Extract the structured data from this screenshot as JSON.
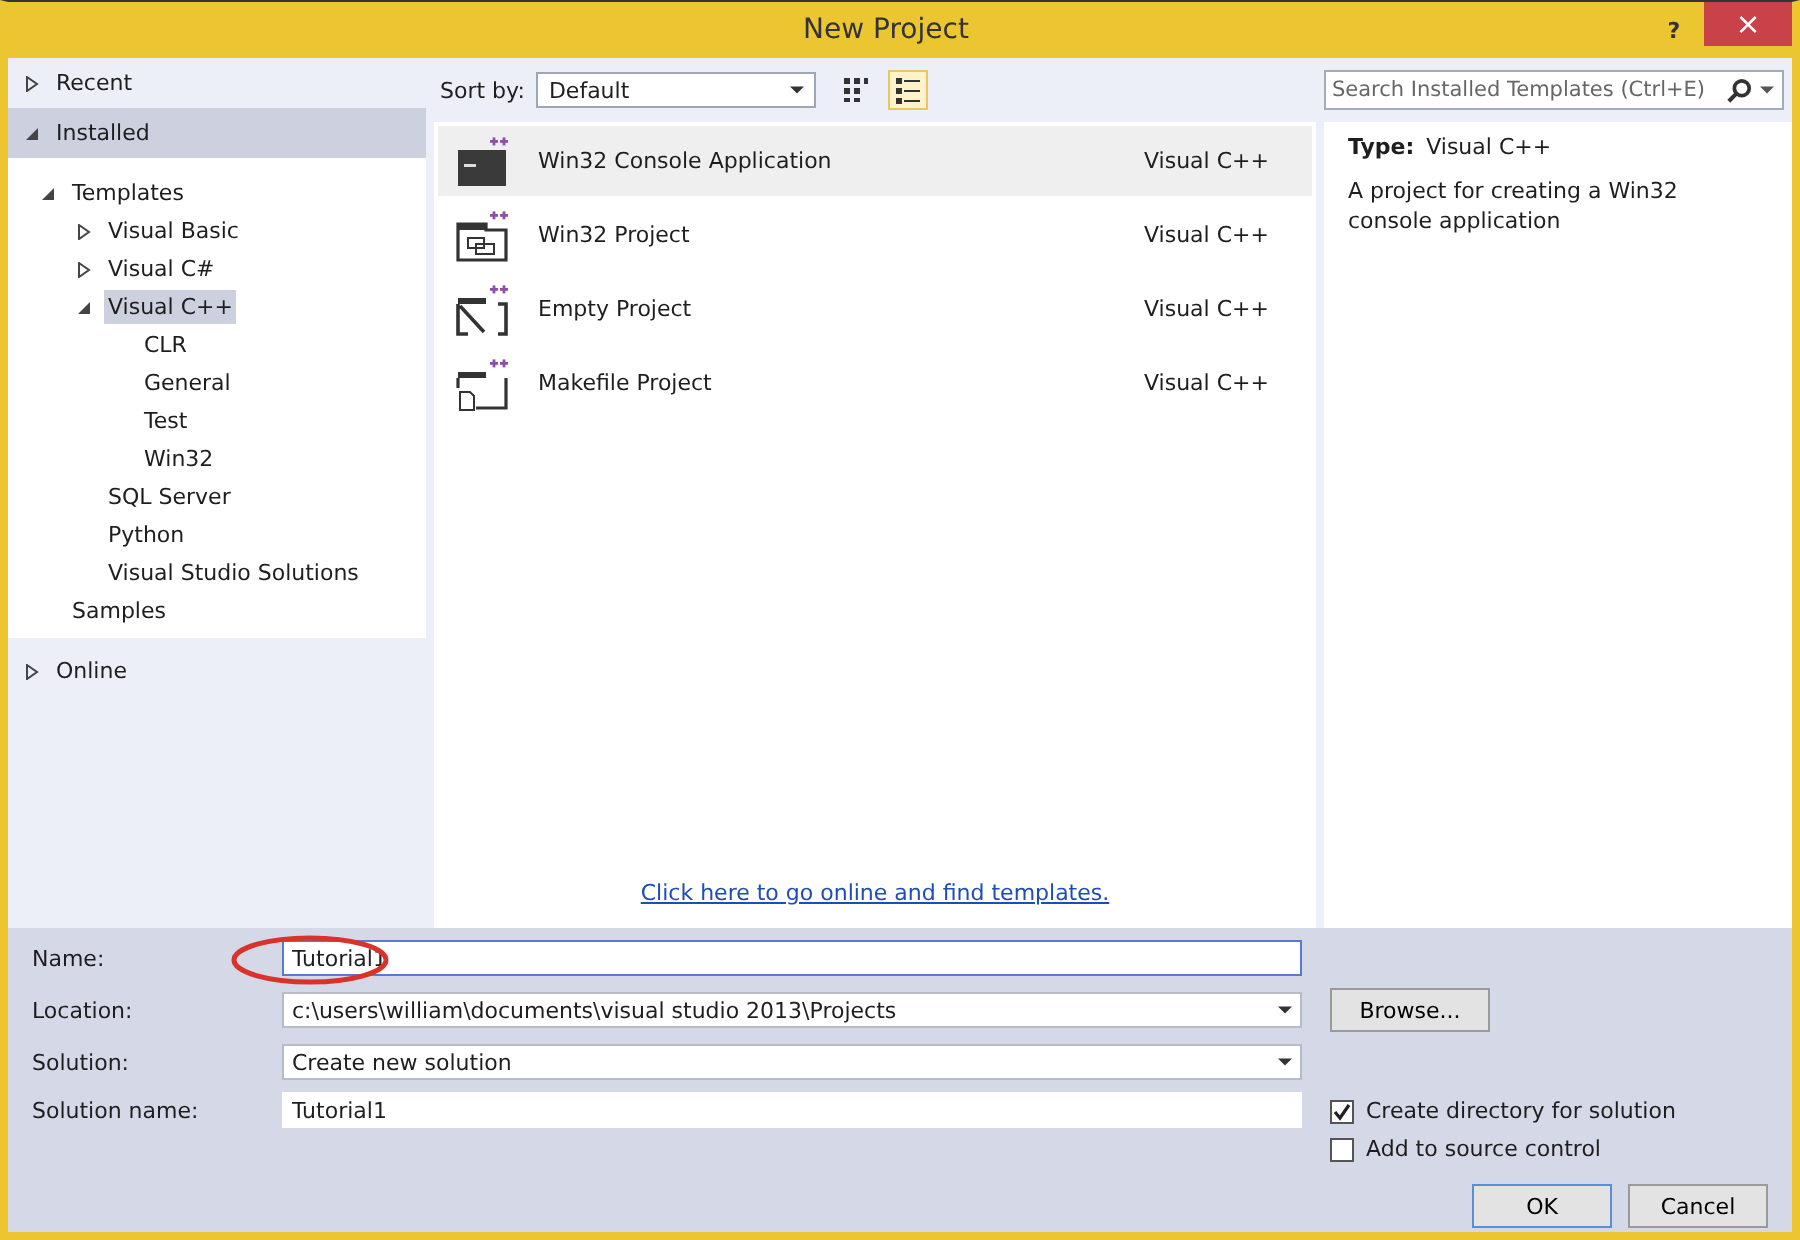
{
  "window": {
    "title": "New Project",
    "help": "?",
    "close": "×"
  },
  "sidebar": {
    "sections": [
      {
        "label": "Recent",
        "expanded": false,
        "selected": false
      },
      {
        "label": "Installed",
        "expanded": true,
        "selected": true,
        "tree": [
          {
            "label": "Templates",
            "expanded": true,
            "selected": false,
            "children": [
              {
                "label": "Visual Basic",
                "expanded": false,
                "selected": false
              },
              {
                "label": "Visual C#",
                "expanded": false,
                "selected": false
              },
              {
                "label": "Visual C++",
                "expanded": true,
                "selected": true,
                "children": [
                  {
                    "label": "CLR",
                    "selected": false
                  },
                  {
                    "label": "General",
                    "selected": false
                  },
                  {
                    "label": "Test",
                    "selected": false
                  },
                  {
                    "label": "Win32",
                    "selected": false
                  }
                ]
              },
              {
                "label": "SQL Server",
                "selected": false
              },
              {
                "label": "Python",
                "selected": false
              },
              {
                "label": "Visual Studio Solutions",
                "selected": false
              }
            ]
          },
          {
            "label": "Samples",
            "selected": false
          }
        ]
      },
      {
        "label": "Online",
        "expanded": false,
        "selected": false
      }
    ]
  },
  "toolbar": {
    "sort_label": "Sort by:",
    "sort_value": "Default",
    "views": [
      {
        "kind": "grid",
        "selected": false
      },
      {
        "kind": "list",
        "selected": true
      }
    ]
  },
  "search": {
    "placeholder": "Search Installed Templates (Ctrl+E)"
  },
  "templates": [
    {
      "name": "Win32 Console Application",
      "language": "Visual C++",
      "kind": "console",
      "selected": true
    },
    {
      "name": "Win32 Project",
      "language": "Visual C++",
      "kind": "win32",
      "selected": false
    },
    {
      "name": "Empty Project",
      "language": "Visual C++",
      "kind": "empty",
      "selected": false
    },
    {
      "name": "Makefile Project",
      "language": "Visual C++",
      "kind": "makefile",
      "selected": false
    }
  ],
  "online_link": "Click here to go online and find templates.",
  "details": {
    "type_label": "Type:",
    "type_value": "Visual C++",
    "description": "A project for creating a Win32 console application"
  },
  "form": {
    "name_label": "Name:",
    "name_value": "Tutorial1",
    "location_label": "Location:",
    "location_value": "c:\\users\\william\\documents\\visual studio 2013\\Projects",
    "solution_label": "Solution:",
    "solution_value": "Create new solution",
    "solution_name_label": "Solution name:",
    "solution_name_value": "Tutorial1",
    "browse": "Browse..."
  },
  "options": [
    {
      "label": "Create directory for solution",
      "checked": true
    },
    {
      "label": "Add to source control",
      "checked": false
    }
  ],
  "buttons": [
    {
      "label": "OK",
      "default": true
    },
    {
      "label": "Cancel",
      "default": false
    }
  ]
}
